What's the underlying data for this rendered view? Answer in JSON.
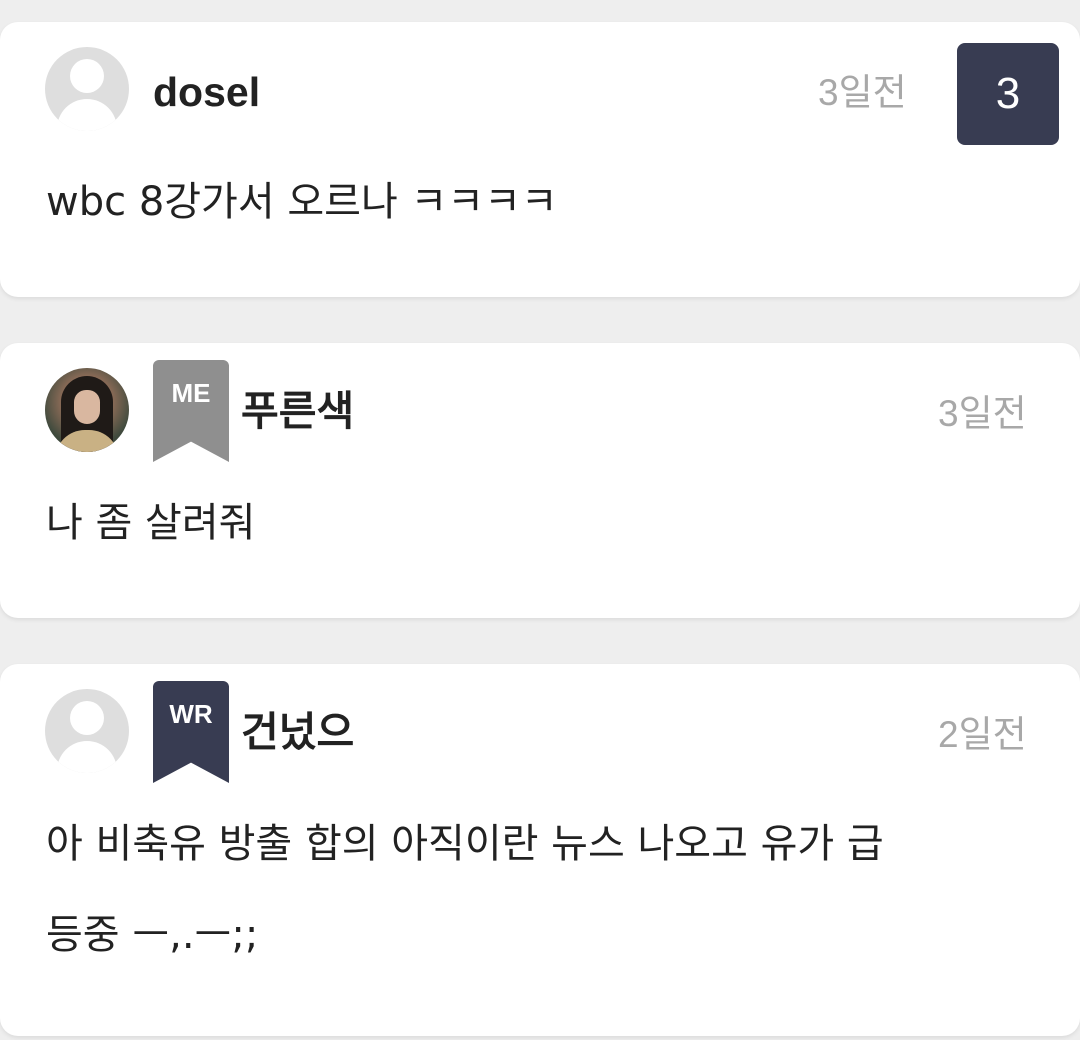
{
  "comments": [
    {
      "username": "dosel",
      "time": "3일전",
      "reply_count": "3",
      "badge": "",
      "avatar": "default-avatar",
      "text": "wbc 8강가서 오르나 ㅋㅋㅋㅋ"
    },
    {
      "username": "푸른색",
      "time": "3일전",
      "badge": "ME",
      "avatar": "photo-avatar",
      "text": "나 좀 살려줘"
    },
    {
      "username": "건넜으",
      "time": "2일전",
      "badge": "WR",
      "avatar": "default-avatar",
      "text": "아 비축유 방출 합의 아직이란 뉴스 나오고 유가 급\n등중 ㅡ,.ㅡ;;"
    }
  ],
  "colors": {
    "page_background": "#eeeeee",
    "card_background": "#ffffff",
    "badge_me": "#8f8f8f",
    "badge_wr": "#383c52",
    "reply_count_badge": "#383c52",
    "muted_text": "#a8a8a8"
  }
}
